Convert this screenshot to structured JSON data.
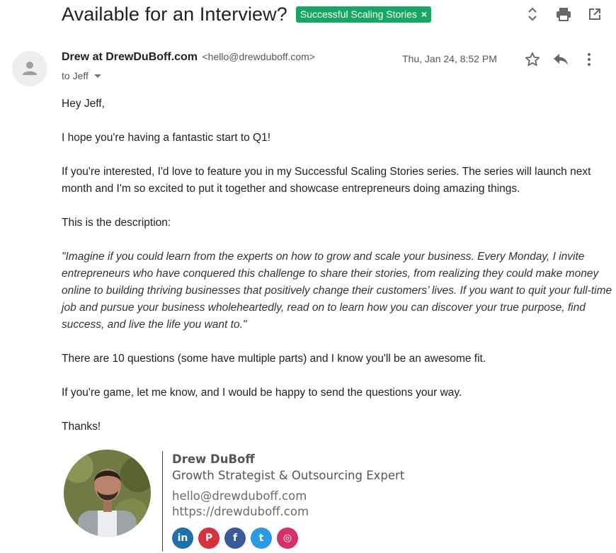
{
  "subject": "Available for an Interview?",
  "label": {
    "text": "Successful Scaling Stories",
    "remove": "×",
    "color": "#16a765"
  },
  "toolbar": {
    "icons": [
      "expand-collapse-icon",
      "print-icon",
      "open-in-new-window-icon"
    ]
  },
  "message": {
    "sender_name": "Drew at DrewDuBoff.com",
    "sender_email": "<hello@drewduboff.com>",
    "to": "to Jeff",
    "date": "Thu, Jan 24, 8:52 PM",
    "icons": [
      "star-icon",
      "reply-icon",
      "more-vert-icon"
    ]
  },
  "body": {
    "greeting": "Hey Jeff,",
    "p1": "I hope you're having a fantastic start to Q1!",
    "p2": "If you're interested, I'd love to feature you in my Successful Scaling Stories series. The series will launch next month and I'm so excited to put it together and showcase entrepreneurs doing amazing things.",
    "p3": "This is the description:",
    "quote": "\"Imagine if you could learn from the experts on how to grow and scale your business. Every Monday, I invite entrepreneurs who have conquered this challenge to share their stories, from realizing they could make money online to building thriving businesses that positively change their customers’ lives. If you want to quit your full-time job and pursue your business wholeheartedly, read on to learn how you can discover your true purpose, find success, and live the life you want to.\"",
    "p4": "There are 10 questions (some have multiple parts) and I know you'll be an awesome fit.",
    "p5": "If you're game, let me know, and I would be happy to send the questions your way.",
    "closing": "Thanks!"
  },
  "signature": {
    "name": "Drew DuBoff",
    "title": "Growth Strategist & Outsourcing Expert",
    "email": "hello@drewduboff.com",
    "website": "https://drewduboff.com",
    "socials": [
      {
        "name": "linkedin-icon",
        "glyph": "in",
        "color": "#1f6fa8"
      },
      {
        "name": "pinterest-icon",
        "glyph": "P",
        "color": "#d8313d"
      },
      {
        "name": "facebook-icon",
        "glyph": "f",
        "color": "#3a5a99"
      },
      {
        "name": "twitter-icon",
        "glyph": "t",
        "color": "#2a9be0"
      },
      {
        "name": "instagram-icon",
        "glyph": "◎",
        "color": "#d6306a"
      }
    ]
  }
}
